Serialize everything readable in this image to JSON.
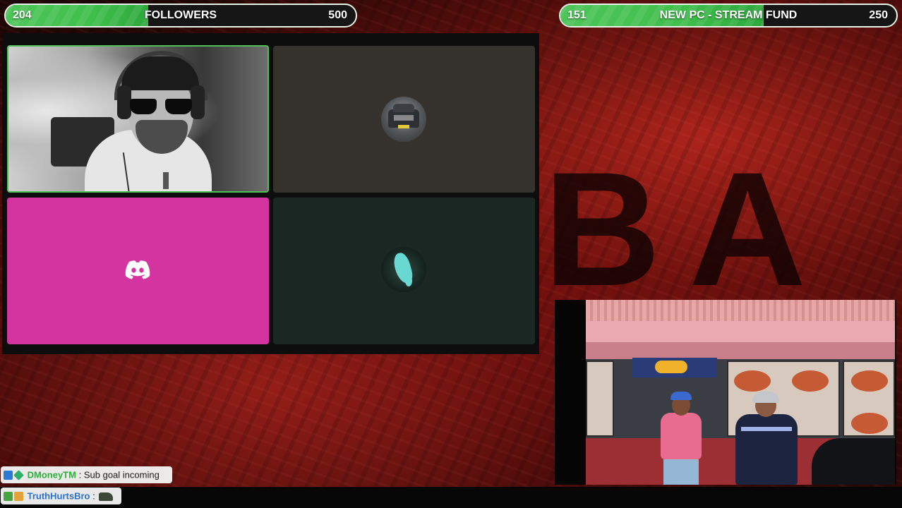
{
  "goals": {
    "followers": {
      "current": "204",
      "title": "FOLLOWERS",
      "target": "500",
      "progress": 0.408
    },
    "fund": {
      "current": "151",
      "title": "NEW PC - STREAM FUND",
      "target": "250",
      "progress": 0.604
    }
  },
  "call": {
    "tiles": [
      {
        "kind": "webcam",
        "speaking": true
      },
      {
        "kind": "avatar",
        "icon": "truck-avatar-icon"
      },
      {
        "kind": "discord",
        "icon": "discord-icon"
      },
      {
        "kind": "avatar",
        "icon": "ghost-avatar-icon"
      }
    ]
  },
  "chat": {
    "messages": [
      {
        "user": "DMoneyTM",
        "separator": ":",
        "text": "Sub goal incoming",
        "badges": [
          "sub-badge-icon",
          "diamond-badge-icon"
        ]
      },
      {
        "user": "TruthHurtsBro",
        "separator": ":",
        "text": "",
        "emote": "truck-emote-icon",
        "badges": [
          "gift-badge-icon",
          "box-badge-icon"
        ]
      }
    ]
  },
  "background": {
    "letters": "BA"
  },
  "colors": {
    "goal_fill": "#3fbf4c",
    "speaking_border": "#4fbf56",
    "discord_tile": "#d4349f",
    "username_green": "#2bb03c",
    "username_blue": "#2d72c9"
  }
}
